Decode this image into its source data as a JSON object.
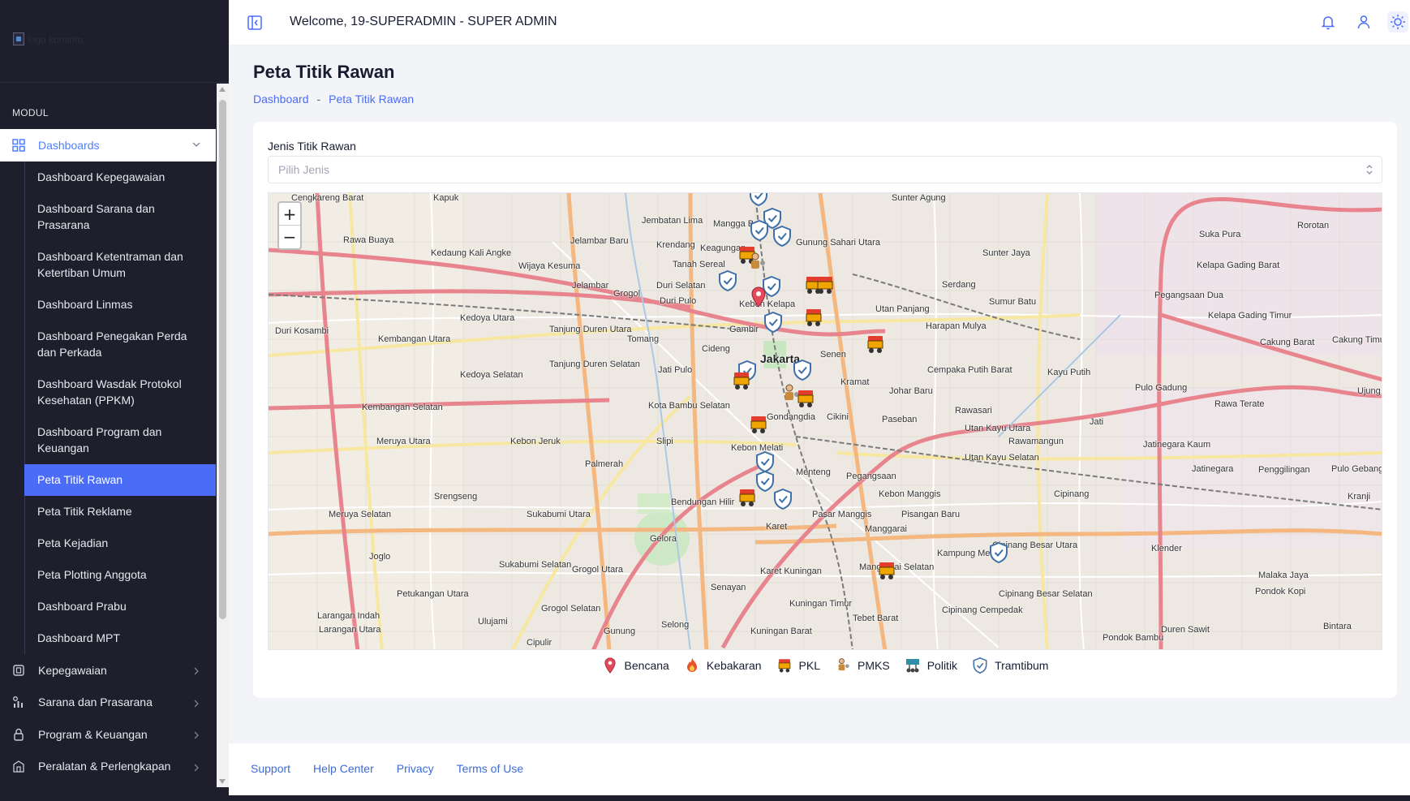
{
  "app": {
    "logo_alt": "logo kominfo"
  },
  "sidebar": {
    "section_title": "MODUL",
    "dashboards": {
      "label": "Dashboards",
      "items": [
        "Dashboard Kepegawaian",
        "Dashboard Sarana dan Prasarana",
        "Dashboard Ketentraman dan Ketertiban Umum",
        "Dashboard Linmas",
        "Dashboard Penegakan Perda dan Perkada",
        "Dashboard Wasdak Protokol Kesehatan (PPKM)",
        "Dashboard Program dan Keuangan",
        "Peta Titik Rawan",
        "Peta Titik Reklame",
        "Peta Kejadian",
        "Peta Plotting Anggota",
        "Dashboard Prabu",
        "Dashboard MPT"
      ],
      "active_item": "Peta Titik Rawan"
    },
    "groups": [
      {
        "label": "Kepegawaian",
        "icon": "id-card-icon"
      },
      {
        "label": "Sarana dan Prasarana",
        "icon": "chart-icon"
      },
      {
        "label": "Program & Keuangan",
        "icon": "lock-icon"
      },
      {
        "label": "Peralatan & Perlengkapan",
        "icon": "building-icon"
      }
    ]
  },
  "header": {
    "welcome": "Welcome, 19-SUPERADMIN - SUPER ADMIN",
    "icons": [
      "bell-icon",
      "user-icon",
      "sun-icon"
    ]
  },
  "page": {
    "title": "Peta Titik Rawan",
    "breadcrumb": [
      "Dashboard",
      "Peta Titik Rawan"
    ]
  },
  "filter": {
    "label": "Jenis Titik Rawan",
    "placeholder": "Pilih Jenis"
  },
  "map": {
    "zoom_in": "+",
    "zoom_out": "−",
    "city_label": "Jakarta",
    "place_labels": [
      "Cengkareng Barat",
      "Kapuk",
      "Jembatan Lima",
      "Mangga Besar",
      "Gunung Sahari Utara",
      "Sunter Agung",
      "Sunter Jaya",
      "Suka Pura",
      "Rorotan",
      "Kedaung Kali Angke",
      "Wijaya Kesuma",
      "Jelambar Baru",
      "Krendang",
      "Keagungan",
      "Tanah Sereal",
      "Jelambar",
      "Grogol",
      "Duri Selatan",
      "Duri Pulo",
      "Kebon Kelapa",
      "Gambir",
      "Senen",
      "Kramat",
      "Johar Baru",
      "Utan Panjang",
      "Harapan Mulya",
      "Serdang",
      "Sumur Batu",
      "Kelapa Gading Barat",
      "Pegangsaan Dua",
      "Kelapa Gading Timur",
      "Cakung Barat",
      "Cakung Timur",
      "Rawa Buaya",
      "Duri Kosambi",
      "Kembangan Utara",
      "Kedoya Utara",
      "Kedoya Selatan",
      "Tanjung Duren Utara",
      "Tanjung Duren Selatan",
      "Tomang",
      "Jati Pulo",
      "Cideng",
      "Kota Bambu Selatan",
      "Slipi",
      "Cempaka Putih Barat",
      "Kayu Putih",
      "Pulo Gadung",
      "Rawa Terate",
      "Ujung",
      "Kembangan Selatan",
      "Meruya Utara",
      "Kebon Jeruk",
      "Palmerah",
      "Kebon Melati",
      "Gondangdia",
      "Cikini",
      "Paseban",
      "Rawasari",
      "Utan Kayu Utara",
      "Utan Kayu Selatan",
      "Rawamangun",
      "Jati",
      "Jatinegara Kaum",
      "Jatinegara",
      "Penggilingan",
      "Pulo Gebang",
      "Kranji",
      "Srengseng",
      "Meruya Selatan",
      "Sukabumi Utara",
      "Bendungan Hilir",
      "Menteng",
      "Pegangsaan",
      "Kebon Manggis",
      "Pisangan Baru",
      "Cipinang",
      "Gelora",
      "Karet",
      "Pasar Manggis",
      "Manggarai",
      "Kampung Melayu",
      "Cipinang Besar Utara",
      "Klender",
      "Malaka Jaya",
      "Joglo",
      "Sukabumi Selatan",
      "Grogol Utara",
      "Senayan",
      "Karet Kuningan",
      "Manggarai Selatan",
      "Kuningan Timur",
      "Tebet Barat",
      "Cipinang Besar Selatan",
      "Cipinang Cempedak",
      "Pondok Kopi",
      "Duren Sawit",
      "Bintara",
      "Larangan Indah",
      "Petukangan Utara",
      "Ulujami",
      "Grogol Selatan",
      "Gunung",
      "Selong",
      "Kuningan Barat",
      "Cipulir",
      "Pondok Bambu",
      "Larangan Utara"
    ]
  },
  "legend": [
    {
      "label": "Bencana",
      "icon": "pin-icon",
      "color": "#e24a5a"
    },
    {
      "label": "Kebakaran",
      "icon": "fire-icon",
      "color": "#e8542a"
    },
    {
      "label": "PKL",
      "icon": "cart-icon",
      "color": "#f0a500"
    },
    {
      "label": "PMKS",
      "icon": "person-icon",
      "color": "#c98a3a"
    },
    {
      "label": "Politik",
      "icon": "protest-icon",
      "color": "#2f8fa8"
    },
    {
      "label": "Tramtibum",
      "icon": "shield-icon",
      "color": "#3f6fa8"
    }
  ],
  "footer": {
    "links": [
      "Support",
      "Help Center",
      "Privacy",
      "Terms of Use"
    ]
  },
  "colors": {
    "sidebar_bg": "#1e1e2d",
    "accent": "#4a6cf7",
    "link": "#3f6bd6"
  }
}
